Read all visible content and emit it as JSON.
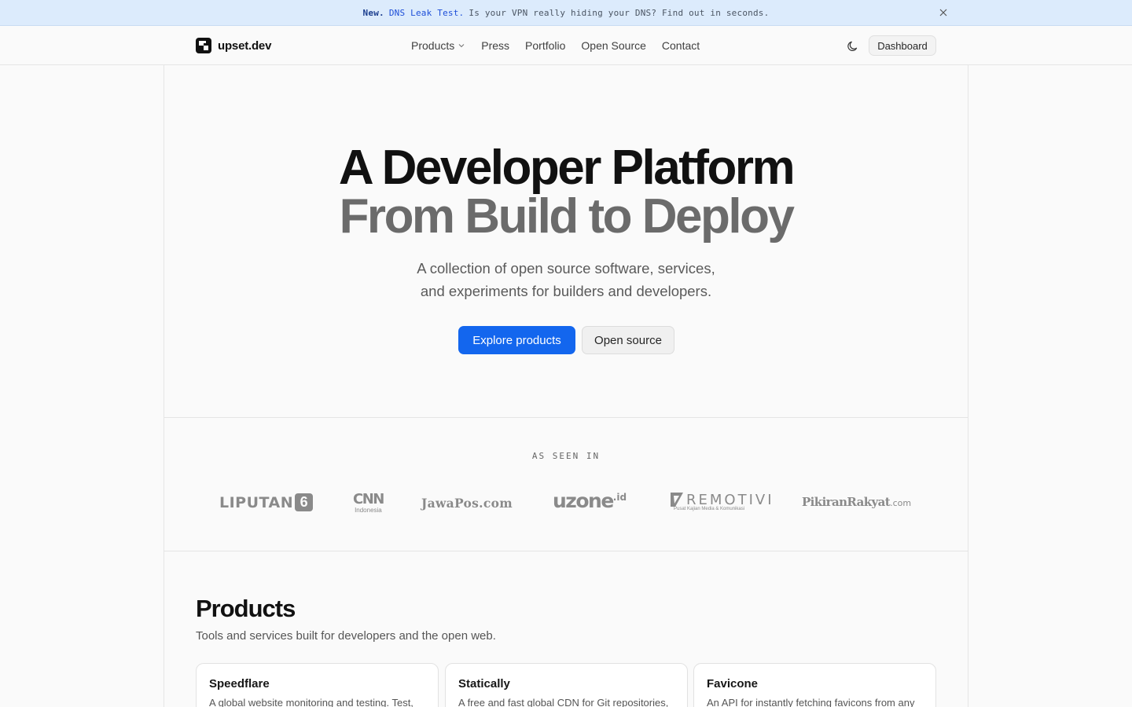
{
  "banner": {
    "new_label": "New.",
    "link_text": "DNS Leak Test.",
    "message": "Is your VPN really hiding your DNS? Find out in seconds.",
    "close_icon": "close-icon"
  },
  "header": {
    "logo_text": "upset.dev",
    "nav": [
      {
        "label": "Products",
        "has_dropdown": true
      },
      {
        "label": "Press"
      },
      {
        "label": "Portfolio"
      },
      {
        "label": "Open Source"
      },
      {
        "label": "Contact"
      }
    ],
    "theme_icon": "moon-icon",
    "dashboard_label": "Dashboard"
  },
  "hero": {
    "title_line1": "A Developer Platform",
    "title_line2": "From Build to Deploy",
    "subtitle_line1": "A collection of open source software, services,",
    "subtitle_line2": "and experiments for builders and developers.",
    "primary_cta": "Explore products",
    "secondary_cta": "Open source"
  },
  "press": {
    "label": "AS SEEN IN",
    "logos": [
      {
        "name": "liputan6-logo",
        "text": "LIPUTAN",
        "suffix": "6"
      },
      {
        "name": "cnn-indonesia-logo",
        "text": "CNN",
        "sub": "Indonesia"
      },
      {
        "name": "jawapos-logo",
        "text": "JawaPos.com"
      },
      {
        "name": "uzone-logo",
        "text": "uzone",
        "suffix": ".id"
      },
      {
        "name": "remotivi-logo",
        "text": "REMOTIVI",
        "sub": "Pusat Kajian Media & Komunikasi"
      },
      {
        "name": "pikiran-rakyat-logo",
        "text": "PikiranRakyat",
        "suffix": ".com"
      }
    ]
  },
  "products": {
    "title": "Products",
    "subtitle": "Tools and services built for developers and the open web.",
    "cards": [
      {
        "title": "Speedflare",
        "desc": "A global website monitoring and testing. Test,"
      },
      {
        "title": "Statically",
        "desc": "A free and fast global CDN for Git repositories,"
      },
      {
        "title": "Favicone",
        "desc": "An API for instantly fetching favicons from any"
      }
    ]
  },
  "colors": {
    "accent": "#1366ee",
    "banner_bg": "#dcebfc"
  }
}
